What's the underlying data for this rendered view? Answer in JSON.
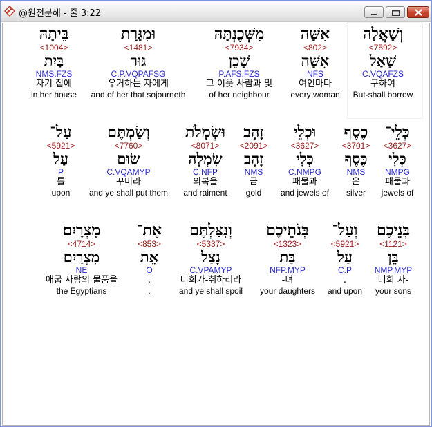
{
  "window": {
    "title": "@원전분해 - 줄 3:22"
  },
  "rows": [
    {
      "words": [
        {
          "hebrew": "וְשָׁאֲלָה",
          "strong": "<7592>",
          "lemma": "שָׁאַל",
          "code": "C.VQAFZS",
          "korean": "구하여",
          "english": "But-shall borrow"
        },
        {
          "hebrew": "אִשָּׁה",
          "strong": "<802>",
          "lemma": "אִשָּׁה",
          "code": "NFS",
          "korean": "여인마다",
          "english": "every woman"
        },
        {
          "hebrew": "מִשְּׁכֶנְתָּהּ",
          "strong": "<7934>",
          "lemma": "שָׁכֵן",
          "code": "P.AFS.FZS",
          "korean": "그 이웃 사람과 및",
          "english": "of her neighbour"
        },
        {
          "hebrew": "וּמִגָּרַת",
          "strong": "<1481>",
          "lemma": "גּוּר",
          "code": "C.P.VQPAFSG",
          "korean": "우거하는 자에게",
          "english": "and of her that sojourneth"
        },
        {
          "hebrew": "בֵּיתָהּ",
          "strong": "<1004>",
          "lemma": "בַּיִת",
          "code": "NMS.FZS",
          "korean": "자기 집에",
          "english": "in her house"
        }
      ]
    },
    {
      "words": [
        {
          "hebrew": "כְּלֵי־",
          "strong": "<3627>",
          "lemma": "כְּלִי",
          "code": "NMPG",
          "korean": "패물과",
          "english": "jewels of"
        },
        {
          "hebrew": "כֶסֶף",
          "strong": "<3701>",
          "lemma": "כֶּסֶף",
          "code": "NMS",
          "korean": "은",
          "english": "silver"
        },
        {
          "hebrew": "וּכְלֵי",
          "strong": "<3627>",
          "lemma": "כְּלִי",
          "code": "C.NMPG",
          "korean": "패물과",
          "english": "and jewels of"
        },
        {
          "hebrew": "זָהָב",
          "strong": "<2091>",
          "lemma": "זָהָב",
          "code": "NMS",
          "korean": "금",
          "english": "gold"
        },
        {
          "hebrew": "וּשְׂמָלֹת",
          "strong": "<8071>",
          "lemma": "שִׂמְלָה",
          "code": "C.NFP",
          "korean": "의복을",
          "english": "and raiment"
        },
        {
          "hebrew": "וְשַׂמְתֶּם",
          "strong": "<7760>",
          "lemma": "שׂוּם",
          "code": "C.VQAMYP",
          "korean": "꾸미라",
          "english": "and ye shall put them"
        },
        {
          "hebrew": "עַל־",
          "strong": "<5921>",
          "lemma": "עַל",
          "code": "P",
          "korean": "를",
          "english": "upon"
        }
      ]
    },
    {
      "words": [
        {
          "hebrew": "בְּנֵיכֶם",
          "strong": "<1121>",
          "lemma": "בֵּן",
          "code": "NMP.MYP",
          "korean": "너희 자-",
          "english": "your sons"
        },
        {
          "hebrew": "וְעַל־",
          "strong": "<5921>",
          "lemma": "עַל",
          "code": "C.P",
          "korean": ".",
          "english": "and upon"
        },
        {
          "hebrew": "בְּנֹתֵיכֶם",
          "strong": "<1323>",
          "lemma": "בַּת",
          "code": "NFP.MYP",
          "korean": "-녀",
          "english": "your daughters"
        },
        {
          "hebrew": "וְנִצַּלְתֶּם",
          "strong": "<5337>",
          "lemma": "נָצַל",
          "code": "C.VPAMYP",
          "korean": "너희가-취하리라",
          "english": "and ye shall spoil"
        },
        {
          "hebrew": "אֶת־",
          "strong": "<853>",
          "lemma": "אֵת",
          "code": "O",
          "korean": ".",
          "english": "."
        },
        {
          "hebrew": "מִצְרָיִם׃",
          "strong": "<4714>",
          "lemma": "מִצְרַיִם",
          "code": "NE",
          "korean": "애굽 사람의 물품을",
          "english": "the Egyptians"
        }
      ]
    }
  ],
  "colors": {
    "strong_number": "#9a1a1a",
    "morph_code": "#2a2acf",
    "text": "#000000"
  },
  "icons": {
    "app": "app-icon",
    "minimize": "minimize-icon",
    "maximize": "maximize-icon",
    "close": "close-icon"
  }
}
